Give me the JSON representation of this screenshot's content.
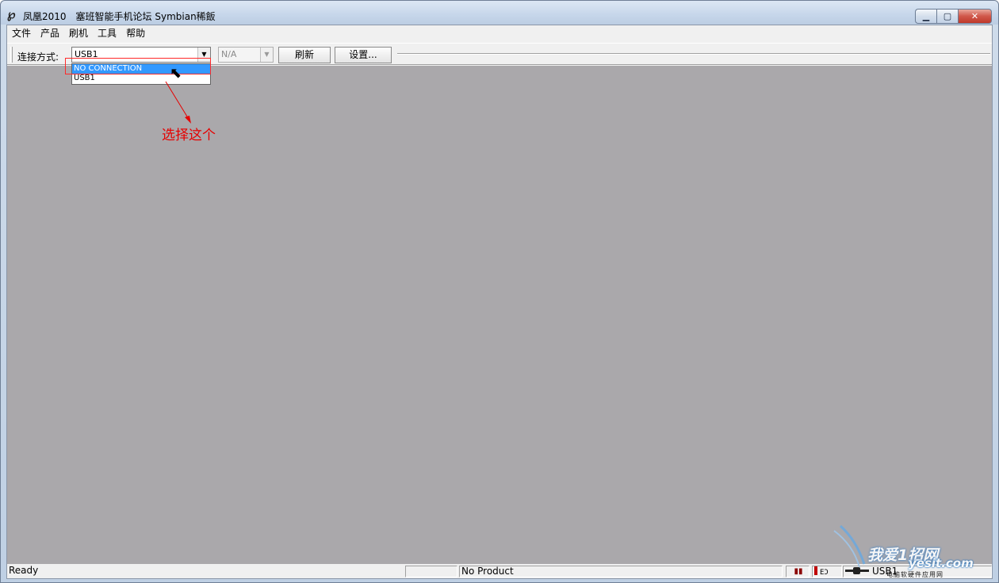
{
  "window": {
    "app_name": "凤凰2010",
    "subtitle": "塞班智能手机论坛 Symbian稀飯",
    "minimize_glyph": "▁",
    "maximize_glyph": "▢",
    "close_glyph": "✕"
  },
  "menu": {
    "items": [
      "文件",
      "产品",
      "刷机",
      "工具",
      "帮助"
    ]
  },
  "toolbar": {
    "connection_label": "连接方式:",
    "connection_value": "USB1",
    "product_value": "N/A",
    "refresh_label": "刷新",
    "settings_label": "设置..."
  },
  "dropdown": {
    "options": [
      "NO CONNECTION",
      "USB1"
    ],
    "selected": "NO CONNECTION"
  },
  "annotation": {
    "text": "选择这个",
    "color": "#e60000"
  },
  "statusbar": {
    "ready": "Ready",
    "product": "No Product",
    "pause": "▮▮",
    "signal": "EƆ",
    "port": "USB1"
  },
  "watermark": {
    "main": "我爱1招网",
    "site": "yesit.com",
    "sub": "电脑软硬件应用网"
  },
  "colors": {
    "workspace": "#aaa8ab",
    "selection": "#3399ff",
    "annotation": "#e60000"
  }
}
